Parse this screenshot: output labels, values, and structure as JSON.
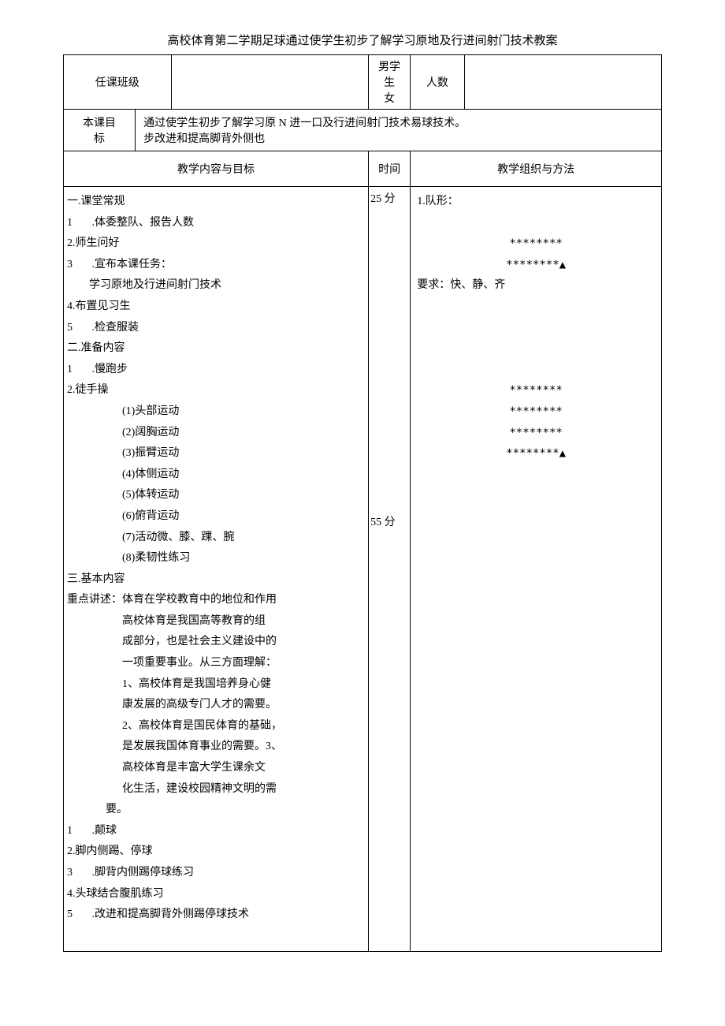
{
  "title": "高校体育第二学期足球通过使学生初步了解学习原地及行进间射门技术教案",
  "row1": {
    "classLabel": "任课班级",
    "genderLabel": "男学生\n女",
    "countLabel": "人数"
  },
  "row2": {
    "goalLabel": "本课目\n标",
    "goalText": "通过使学生初步了解学习原 N 进一口及行进间射门技术易球技术。\n步改进和提高脚背外侧也"
  },
  "headers": {
    "content": "教学内容与目标",
    "time": "时间",
    "method": "教学组织与方法"
  },
  "time1": "25 分",
  "time2": "55 分",
  "content": {
    "s1_title": "一.课堂常规",
    "s1_1": "1       .体委整队、报告人数",
    "s1_2": "2.师生问好",
    "s1_3": "3       .宣布本课任务：",
    "s1_3a": "学习原地及行进间射门技术",
    "s1_4": "4.布置见习生",
    "s1_5": "5       .检查服装",
    "s2_title": "二.准备内容",
    "s2_1": "1       .慢跑步",
    "s2_2": "2.徒手操",
    "ex1": "(1)头部运动",
    "ex2": "(2)阔胸运动",
    "ex3": "(3)振臂运动",
    "ex4": "(4)体侧运动",
    "ex5": "(5)体转运动",
    "ex6": "(6)俯背运动",
    "ex7": "(7)活动微、膝、踝、腕",
    "ex8": "(8)柔韧性练习",
    "s3_title": "三.基本内容",
    "s3_key": "重点讲述：体育在学校教育中的地位和作用",
    "s3_p1": "高校体育是我国高等教育的组",
    "s3_p2": "成部分，也是社会主义建设中的",
    "s3_p3": "一项重要事业。从三方面理解：",
    "s3_p4": "1、高校体育是我国培养身心健",
    "s3_p5": "康发展的高级专门人才的需要。",
    "s3_p6": "2、高校体育是国民体育的基础，",
    "s3_p7": "是发展我国体育事业的需要。3、",
    "s3_p8": "高校体育是丰富大学生课余文",
    "s3_p9": "化生活，建设校园精神文明的需",
    "s3_p10": "要。",
    "s3_i1": "1       .颠球",
    "s3_i2": "2.脚内侧踢、停球",
    "s3_i3": "3       .脚背内侧踢停球练习",
    "s3_i4": "4.头球结合腹肌练习",
    "s3_i5": "5       .改进和提高脚背外侧踢停球技术"
  },
  "method": {
    "m1": "1.队形：",
    "asterisks": "********",
    "asterisksTri": "********▲",
    "req": "要求：快、静、齐"
  }
}
